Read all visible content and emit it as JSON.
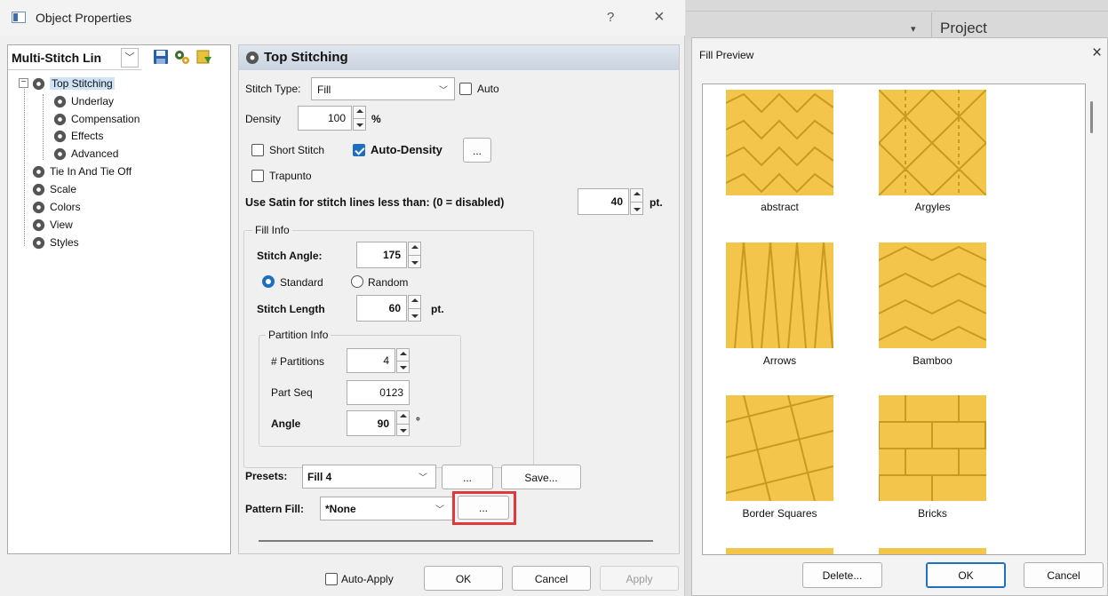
{
  "object_window": {
    "title": "Object Properties",
    "help_glyph": "?",
    "close_glyph": "×"
  },
  "left_panel": {
    "combo_value": "Multi-Stitch Lin",
    "tree": [
      {
        "label": "Top Stitching",
        "selected": true
      },
      {
        "label": "Underlay"
      },
      {
        "label": "Compensation"
      },
      {
        "label": "Effects"
      },
      {
        "label": "Advanced"
      },
      {
        "label": "Tie In And Tie Off"
      },
      {
        "label": "Scale"
      },
      {
        "label": "Colors"
      },
      {
        "label": "View"
      },
      {
        "label": "Styles"
      }
    ]
  },
  "right_panel": {
    "header": "Top Stitching",
    "stitch_type_label": "Stitch Type:",
    "stitch_type_value": "Fill",
    "auto_label": "Auto",
    "density_label": "Density",
    "density_value": "100",
    "density_unit": "%",
    "short_stitch_label": "Short Stitch",
    "auto_density_label": "Auto-Density",
    "ellipsis": "...",
    "trapunto_label": "Trapunto",
    "satin_label": "Use Satin for stitch lines less than: (0 = disabled)",
    "satin_value": "40",
    "pt": "pt.",
    "fill_info": {
      "title": "Fill Info",
      "stitch_angle_label": "Stitch Angle:",
      "stitch_angle_value": "175",
      "standard_label": "Standard",
      "random_label": "Random",
      "stitch_length_label": "Stitch Length",
      "stitch_length_value": "60",
      "partition_info": {
        "title": "Partition Info",
        "partitions_label": "# Partitions",
        "partitions_value": "4",
        "part_seq_label": "Part Seq",
        "part_seq_value": "0123",
        "angle_label": "Angle",
        "angle_value": "90",
        "degree": "°"
      }
    },
    "presets_label": "Presets:",
    "presets_value": "Fill 4",
    "save_label": "Save...",
    "pattern_fill_label": "Pattern Fill:",
    "pattern_fill_value": "*None"
  },
  "bottom_bar": {
    "auto_apply_label": "Auto-Apply",
    "ok_label": "OK",
    "cancel_label": "Cancel",
    "apply_label": "Apply"
  },
  "background": {
    "project_label": "Project",
    "dropdown_glyph": "▾"
  },
  "fill_preview": {
    "title": "Fill Preview",
    "close_glyph": "×",
    "items": [
      "abstract",
      "Argyles",
      "Arrows",
      "Bamboo",
      "Border Squares",
      "Bricks"
    ],
    "delete_label": "Delete...",
    "ok_label": "OK",
    "cancel_label": "Cancel",
    "swatch_color": "#f3c64b",
    "highlight_color": "#e0393b"
  }
}
